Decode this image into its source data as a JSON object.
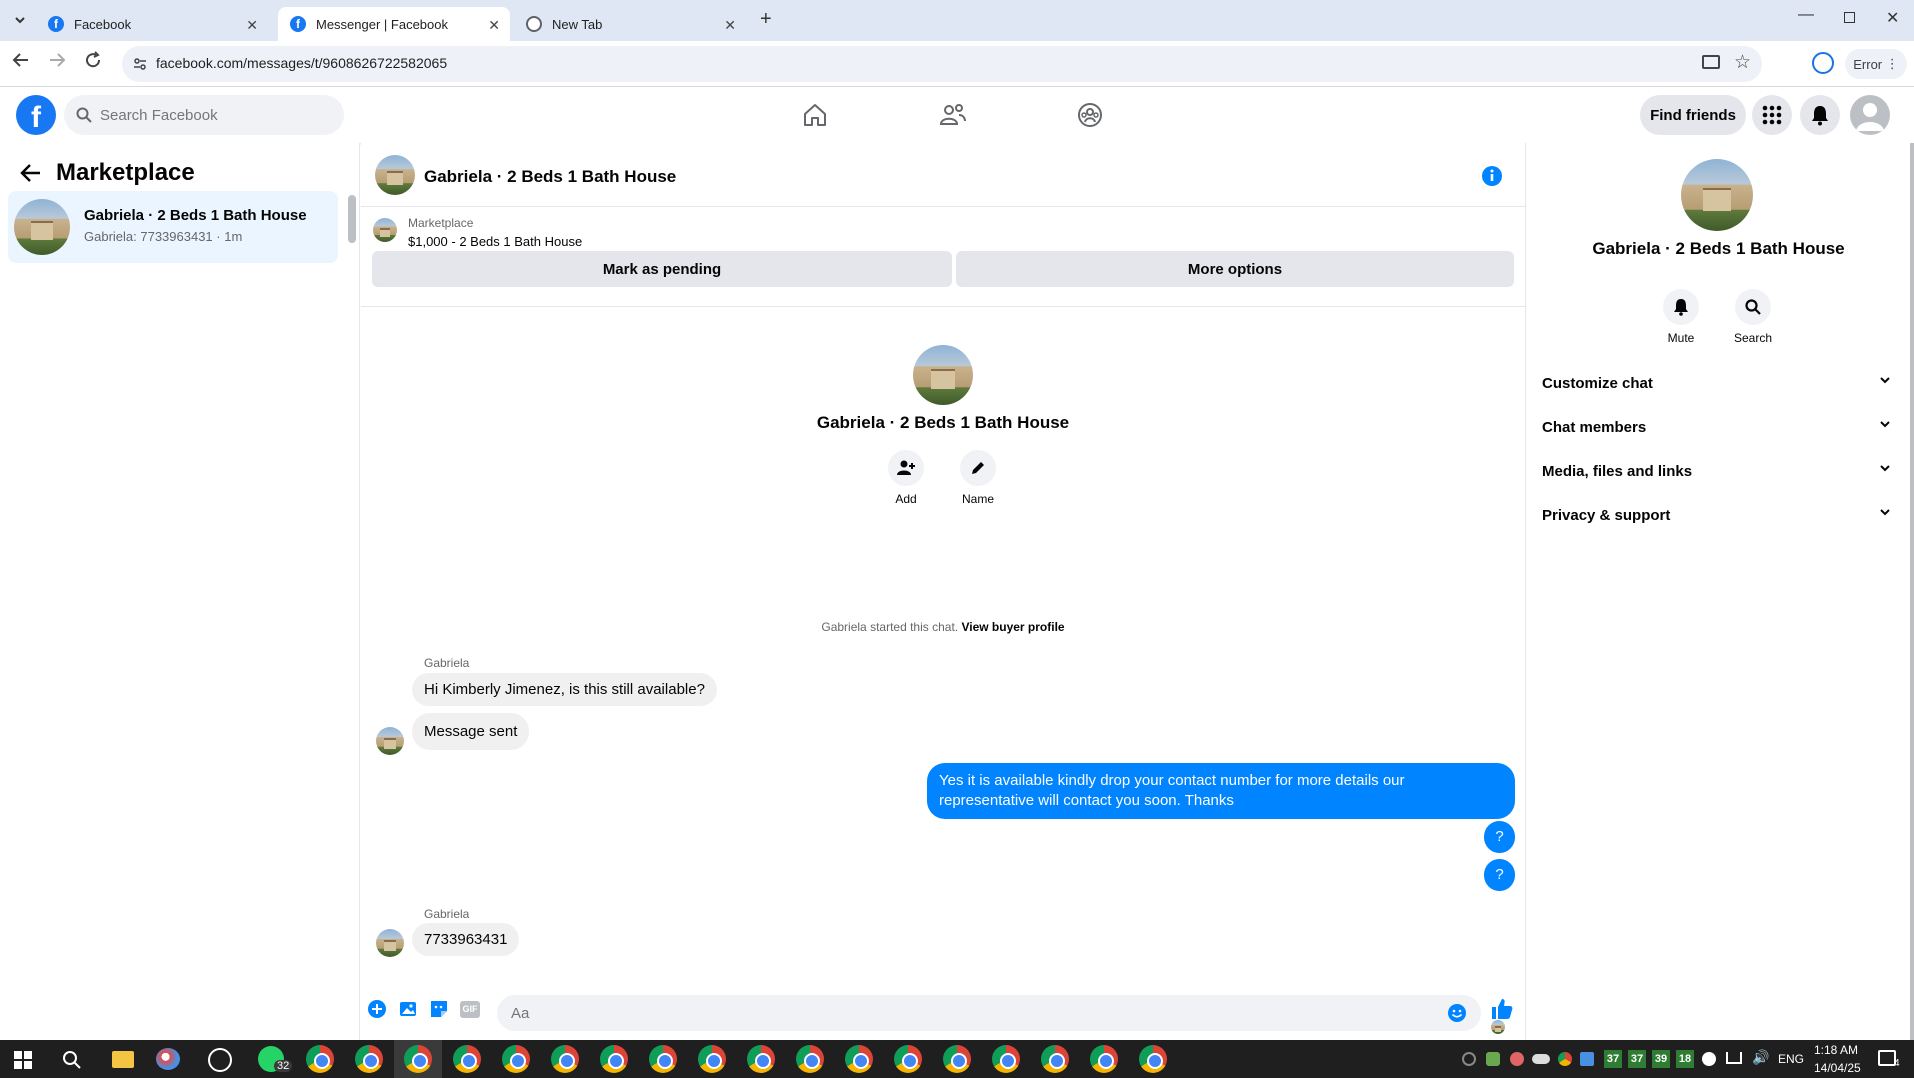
{
  "browser": {
    "tabs": [
      {
        "title": "Facebook",
        "icon": "facebook-icon"
      },
      {
        "title": "Messenger | Facebook",
        "icon": "facebook-icon"
      },
      {
        "title": "New Tab",
        "icon": "globe-icon"
      }
    ],
    "url": "facebook.com/messages/t/9608626722582065",
    "profile_error": "Error"
  },
  "fb": {
    "logo": "f",
    "search_placeholder": "Search Facebook",
    "find_friends": "Find friends"
  },
  "left": {
    "title": "Marketplace",
    "conversation": {
      "name": "Gabriela · 2 Beds 1 Bath House",
      "preview": "Gabriela: 7733963431 · 1m"
    }
  },
  "chat": {
    "header_title": "Gabriela · 2 Beds 1 Bath House",
    "marketplace_label": "Marketplace",
    "listing": "$1,000 - 2 Beds 1 Bath House",
    "mark_pending": "Mark as pending",
    "more_options": "More options",
    "intro_name": "Gabriela · 2 Beds 1 Bath House",
    "add_label": "Add",
    "name_label": "Name",
    "started_text": "Gabriela started this chat.",
    "view_profile": "View buyer profile",
    "sender1": "Gabriela",
    "msg1": "Hi Kimberly Jimenez, is this still available?",
    "msg2": "Message sent",
    "msg_out1_line1": "Yes it is available kindly drop your contact number for more details our",
    "msg_out1_line2": "representative will contact you soon. Thanks",
    "msg_out2": "?",
    "msg_out3": "?",
    "sender2": "Gabriela",
    "msg3": "7733963431",
    "composer_placeholder": "Aa"
  },
  "right": {
    "name": "Gabriela · 2 Beds 1 Bath House",
    "mute": "Mute",
    "search": "Search",
    "sections": [
      "Customize chat",
      "Chat members",
      "Media, files and links",
      "Privacy & support"
    ]
  },
  "taskbar": {
    "whatsapp_badge": "32",
    "lang": "ENG",
    "time": "1:18 AM",
    "date": "14/04/25",
    "tray_numbers": [
      "37",
      "37",
      "39",
      "18"
    ],
    "notif_count": "4"
  },
  "colors": {
    "fb_blue": "#1877f2",
    "messenger_blue": "#0084ff",
    "selected_bg": "#ebf5ff",
    "gray_btn": "#e4e6eb"
  }
}
